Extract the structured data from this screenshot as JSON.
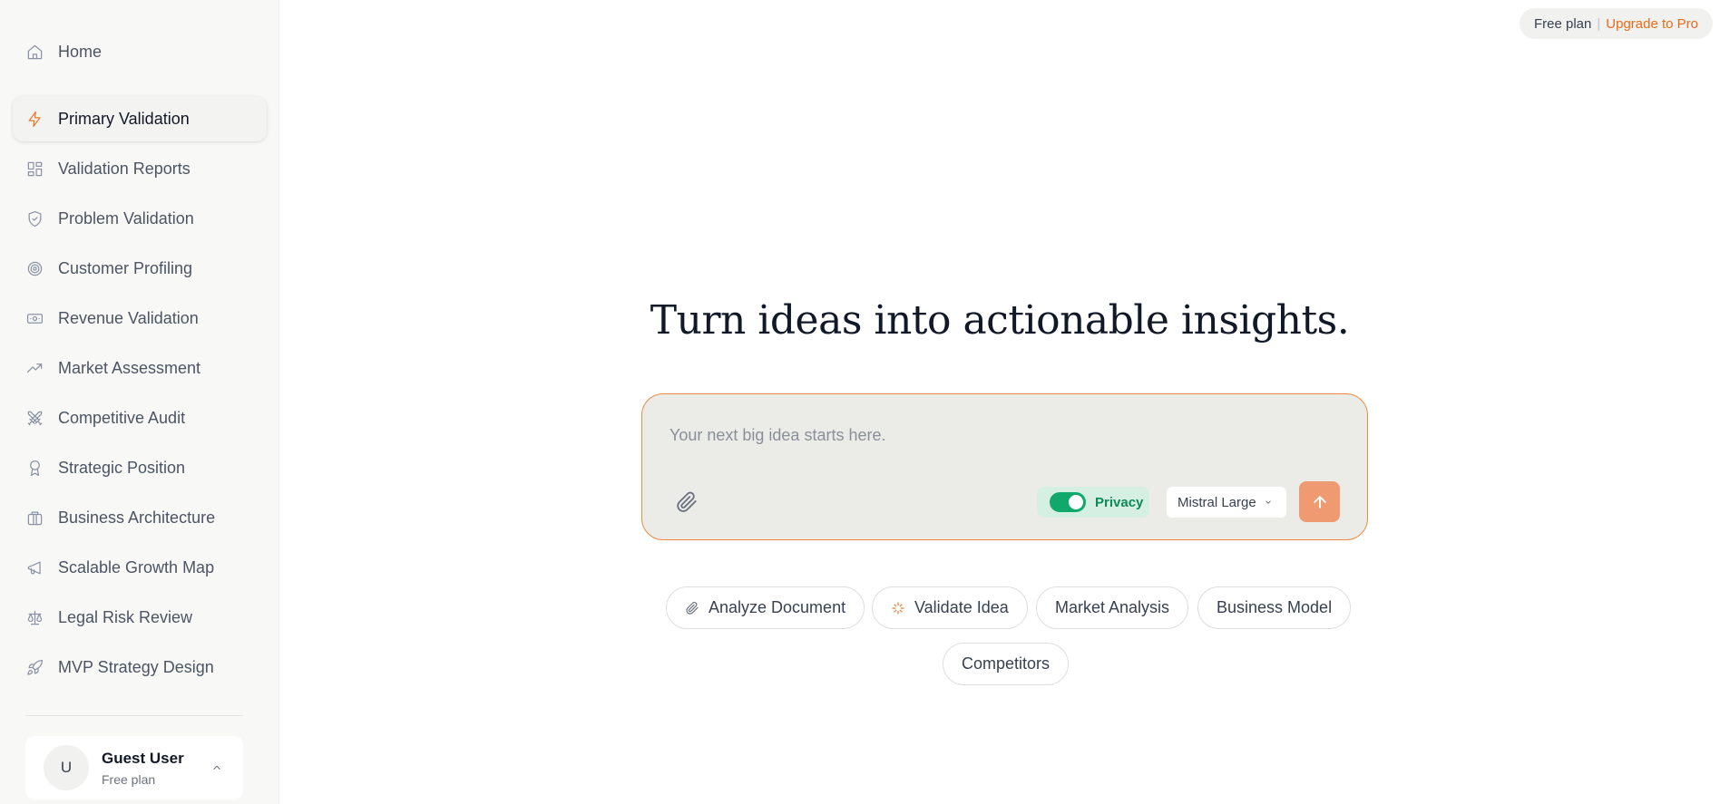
{
  "sidebar": {
    "items": [
      {
        "label": "Home",
        "icon": "home-icon"
      },
      {
        "label": "Primary Validation",
        "icon": "lightning-icon",
        "active": true
      },
      {
        "label": "Validation Reports",
        "icon": "grid-icon"
      },
      {
        "label": "Problem Validation",
        "icon": "shield-check-icon"
      },
      {
        "label": "Customer Profiling",
        "icon": "target-icon"
      },
      {
        "label": "Revenue Validation",
        "icon": "banknote-icon"
      },
      {
        "label": "Market Assessment",
        "icon": "trending-up-icon"
      },
      {
        "label": "Competitive Audit",
        "icon": "swords-icon"
      },
      {
        "label": "Strategic Position",
        "icon": "award-icon"
      },
      {
        "label": "Business Architecture",
        "icon": "briefcase-icon"
      },
      {
        "label": "Scalable Growth Map",
        "icon": "megaphone-icon"
      },
      {
        "label": "Legal Risk Review",
        "icon": "scale-icon"
      },
      {
        "label": "MVP Strategy Design",
        "icon": "rocket-icon"
      }
    ],
    "user": {
      "initial": "U",
      "name": "Guest User",
      "plan": "Free plan"
    }
  },
  "header": {
    "plan_label": "Free plan",
    "separator": "|",
    "upgrade_label": "Upgrade to Pro"
  },
  "main": {
    "headline": "Turn ideas into actionable insights.",
    "composer": {
      "placeholder": "Your next big idea starts here.",
      "value": "",
      "privacy_label": "Privacy",
      "privacy_enabled": true,
      "model": "Mistral Large"
    },
    "chips": [
      {
        "label": "Analyze Document",
        "icon": "paperclip-icon"
      },
      {
        "label": "Validate Idea",
        "icon": "sparkle-icon"
      },
      {
        "label": "Market Analysis"
      },
      {
        "label": "Business Model"
      },
      {
        "label": "Competitors"
      }
    ]
  },
  "colors": {
    "accent": "#ea7a2d",
    "privacy_green": "#10a86b",
    "send_button": "#ef9a70"
  }
}
